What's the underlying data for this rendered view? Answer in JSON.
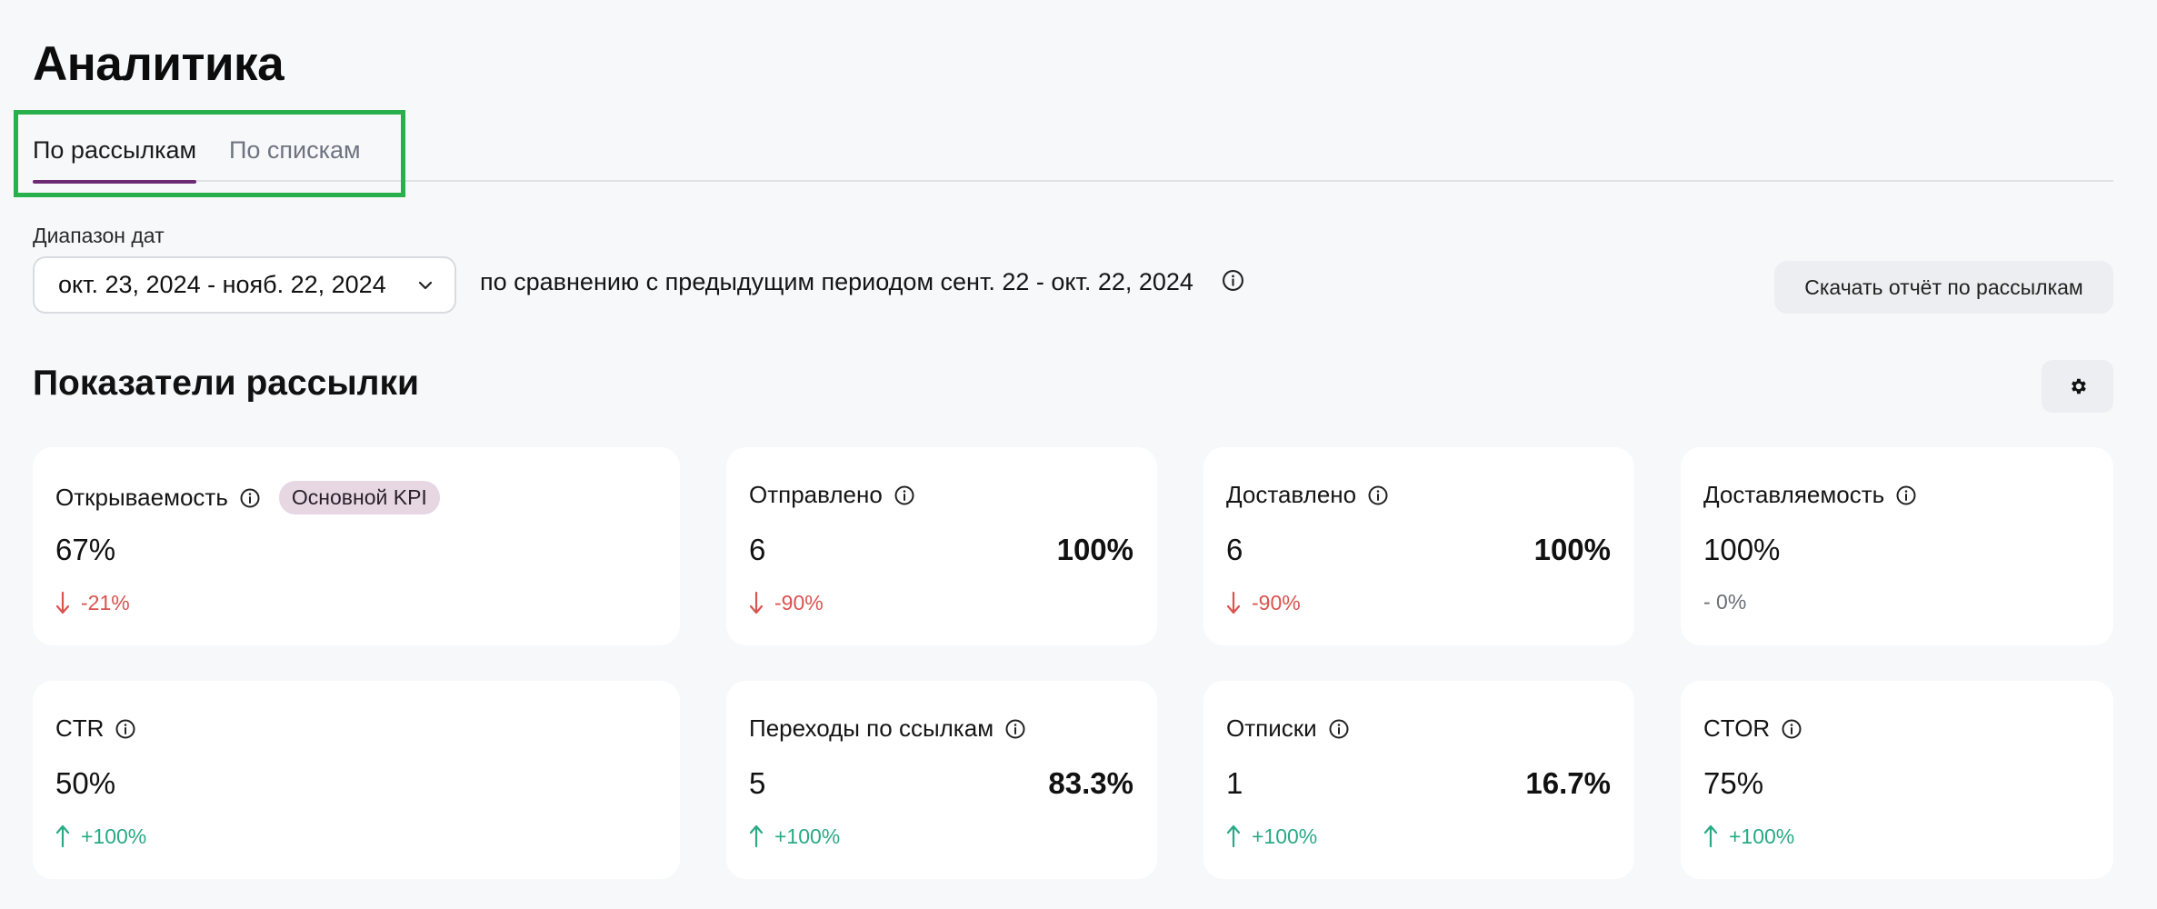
{
  "page": {
    "title": "Аналитика"
  },
  "tabs": [
    {
      "label": "По рассылкам",
      "active": true
    },
    {
      "label": "По спискам",
      "active": false
    }
  ],
  "date_range": {
    "label": "Диапазон дат",
    "value": "окт. 23, 2024 - нояб. 22, 2024",
    "comparison": "по сравнению с предыдущим периодом сент. 22 - окт. 22, 2024"
  },
  "download_button": {
    "label": "Скачать отчёт по рассылкам"
  },
  "section": {
    "title": "Показатели рассылки",
    "settings_icon": "gear-icon"
  },
  "metrics": [
    {
      "title": "Открываемость",
      "badge": "Основной KPI",
      "value": "67%",
      "percent": "",
      "change": "-21%",
      "trend": "down"
    },
    {
      "title": "Отправлено",
      "badge": "",
      "value": "6",
      "percent": "100%",
      "change": "-90%",
      "trend": "down"
    },
    {
      "title": "Доставлено",
      "badge": "",
      "value": "6",
      "percent": "100%",
      "change": "-90%",
      "trend": "down"
    },
    {
      "title": "Доставляемость",
      "badge": "",
      "value": "100%",
      "percent": "",
      "change": "- 0%",
      "trend": "neutral"
    },
    {
      "title": "CTR",
      "badge": "",
      "value": "50%",
      "percent": "",
      "change": "+100%",
      "trend": "up"
    },
    {
      "title": "Переходы по ссылкам",
      "badge": "",
      "value": "5",
      "percent": "83.3%",
      "change": "+100%",
      "trend": "up"
    },
    {
      "title": "Отписки",
      "badge": "",
      "value": "1",
      "percent": "16.7%",
      "change": "+100%",
      "trend": "up"
    },
    {
      "title": "CTOR",
      "badge": "",
      "value": "75%",
      "percent": "",
      "change": "+100%",
      "trend": "up"
    }
  ],
  "colors": {
    "accent": "#6b2a72",
    "negative": "#d9534f",
    "positive": "#2aa986",
    "highlight": "#27b04b"
  }
}
